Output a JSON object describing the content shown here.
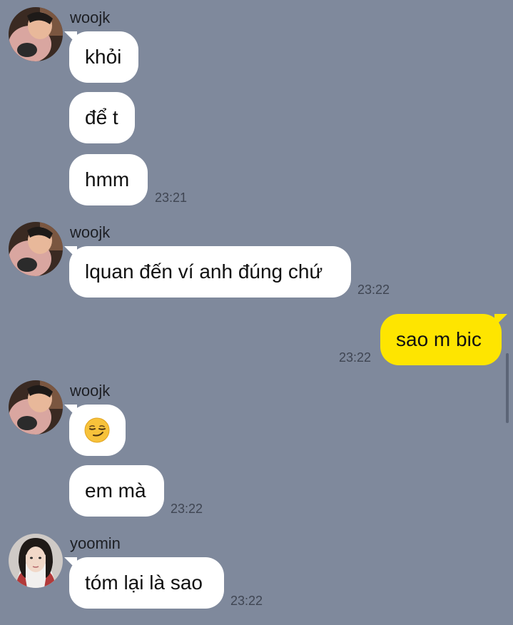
{
  "messages": [
    {
      "sender": "woojk",
      "lines": [
        "khỏi",
        "để t",
        "hmm"
      ],
      "time": "23:21"
    },
    {
      "sender": "woojk",
      "lines": [
        "lquan đến ví anh đúng chứ"
      ],
      "time": "23:22"
    },
    {
      "mine": true,
      "text": "sao m bic",
      "time": "23:22"
    },
    {
      "sender": "woojk",
      "emoji": "smirking-face-emoji",
      "lines": [
        "em mà"
      ],
      "time": "23:22"
    },
    {
      "sender": "yoomin",
      "lines": [
        "tóm lại là sao"
      ],
      "time": "23:22"
    }
  ],
  "colors": {
    "background": "#7f899c",
    "incoming_bubble": "#ffffff",
    "outgoing_bubble": "#fee500",
    "timestamp": "#3f4552"
  }
}
